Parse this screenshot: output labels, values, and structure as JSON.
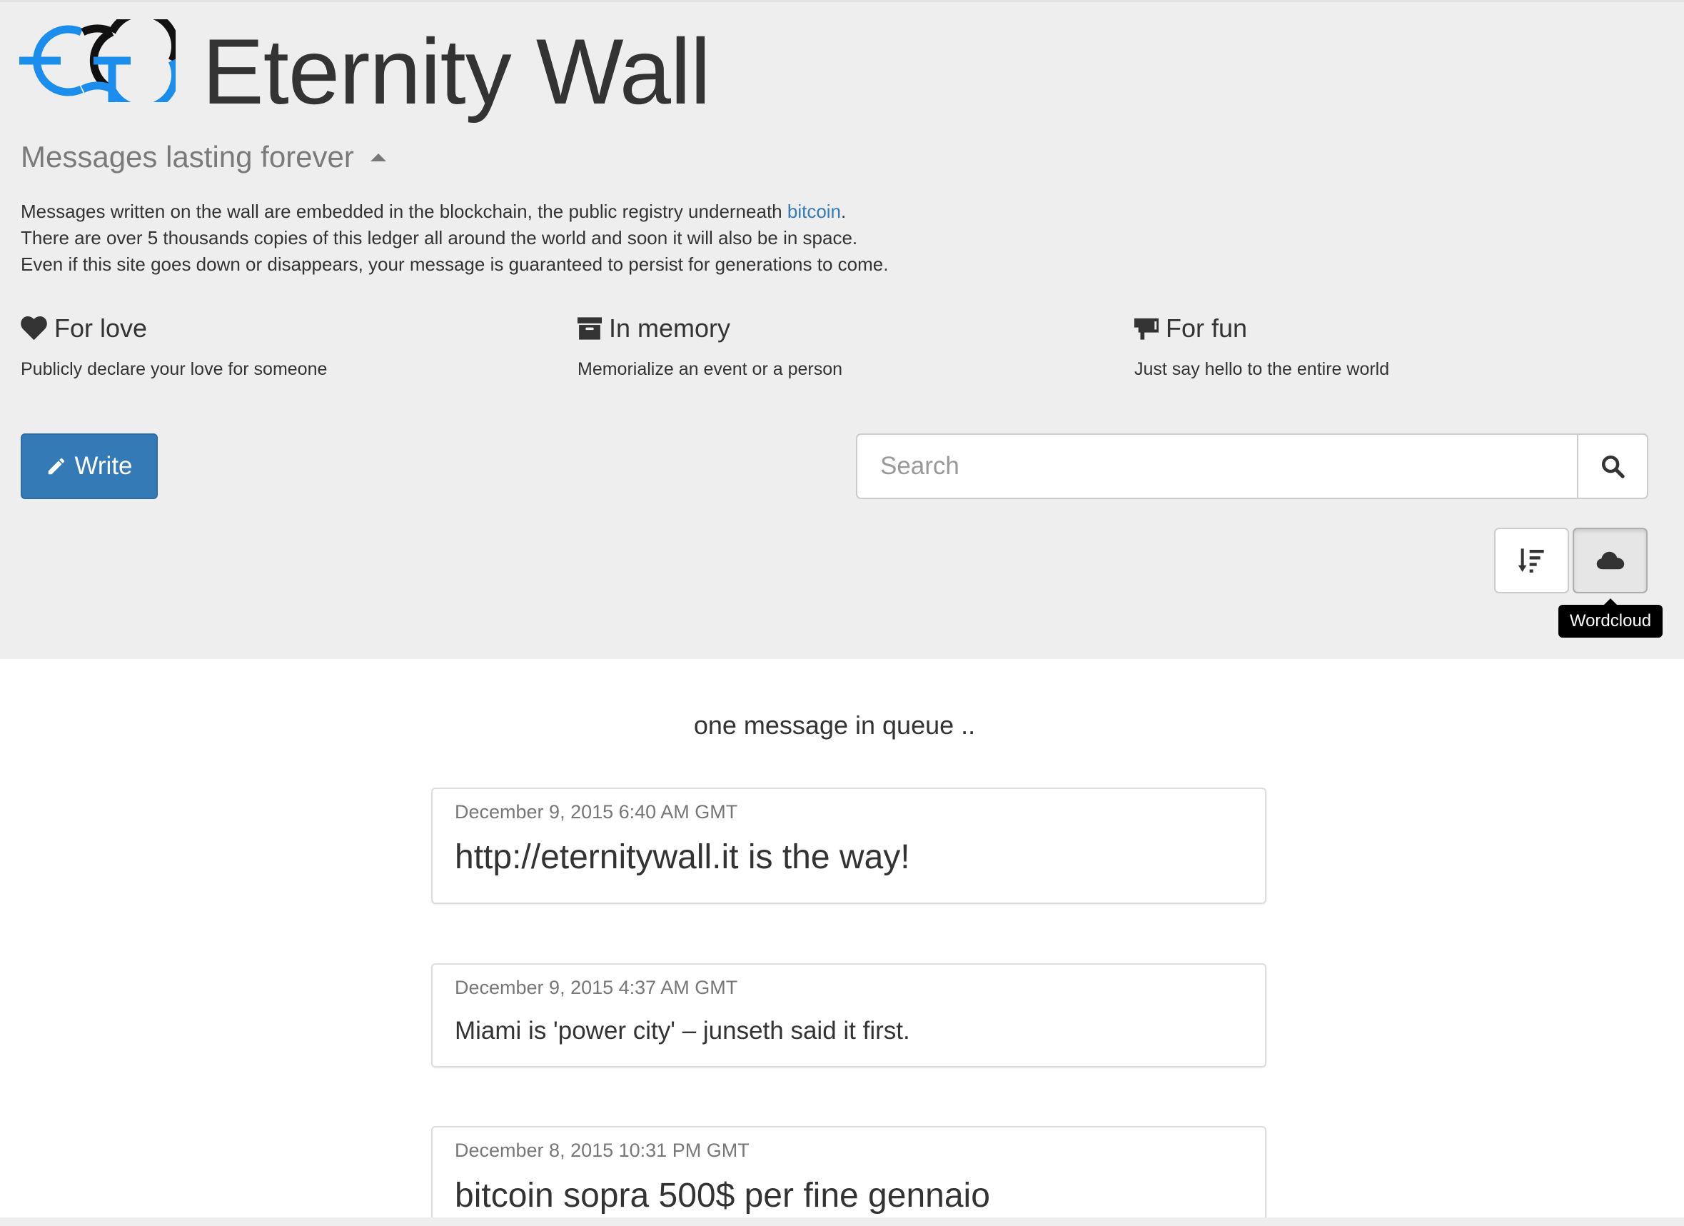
{
  "brand": {
    "title": "Eternity Wall",
    "logo_colors": {
      "blue": "#1a8ded",
      "black": "#111111"
    }
  },
  "tagline": "Messages lasting forever",
  "intro": {
    "line1_before": "Messages written on the wall are embedded in the blockchain, the public registry underneath ",
    "line1_link": "bitcoin",
    "line1_after": ".",
    "line2": "There are over 5 thousands copies of this ledger all around the world and soon it will also be in space.",
    "line3": "Even if this site goes down or disappears, your message is guaranteed to persist for generations to come."
  },
  "features": [
    {
      "icon": "heart-icon",
      "title": "For love",
      "description": "Publicly declare your love for someone"
    },
    {
      "icon": "archive-icon",
      "title": "In memory",
      "description": "Memorialize an event or a person"
    },
    {
      "icon": "bullhorn-icon",
      "title": "For fun",
      "description": "Just say hello to the entire world"
    }
  ],
  "actions": {
    "write_label": "Write",
    "search_placeholder": "Search",
    "sort_icon": "sort-icon",
    "wordcloud_icon": "cloud-icon",
    "wordcloud_tooltip": "Wordcloud"
  },
  "queue_status": "one message in queue ..",
  "messages": [
    {
      "date": "December 9, 2015 6:40 AM GMT",
      "text": "http://eternitywall.it is the way!"
    },
    {
      "date": "December 9, 2015 4:37 AM GMT",
      "text": "Miami is 'power city' – junseth said it first."
    },
    {
      "date": "December 8, 2015 10:31 PM GMT",
      "text": "bitcoin sopra 500$ per fine gennaio"
    }
  ],
  "colors": {
    "primary": "#337ab7",
    "link": "#337ab7",
    "jumbotron_bg": "#eeeeee"
  }
}
